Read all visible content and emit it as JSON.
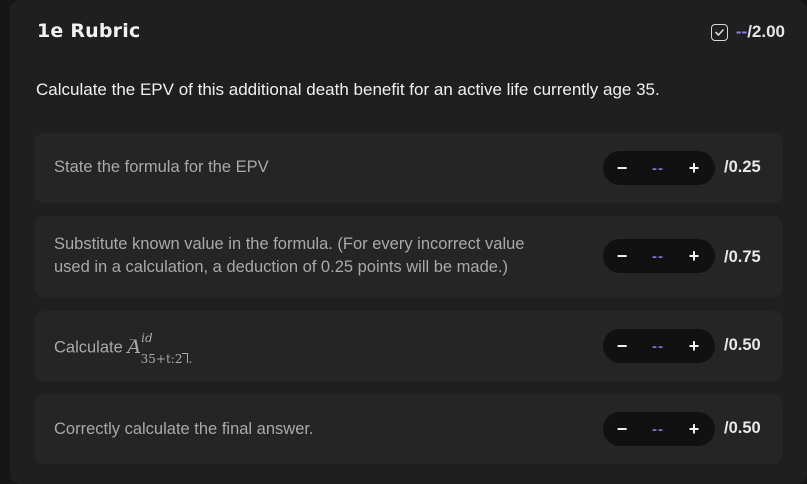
{
  "header": {
    "title": "1e Rubric",
    "score_value": "--",
    "score_max": "/2.00"
  },
  "question": "Calculate the EPV of this additional death benefit for an active life currently age 35.",
  "items": [
    {
      "text": "State the formula for the EPV",
      "value": "--",
      "max": "/0.25",
      "minus": "−",
      "plus": "+"
    },
    {
      "text_line1": "Substitute known value in the formula. (For every incorrect value",
      "text_line2": "used in a calculation, a deduction of 0.25 points will be made.)",
      "value": "--",
      "max": "/0.75",
      "minus": "−",
      "plus": "+"
    },
    {
      "text": "Calculate",
      "math_base": "A",
      "math_sup": "id",
      "math_sub": "35+t:2",
      "value": "--",
      "max": "/0.50",
      "minus": "−",
      "plus": "+"
    },
    {
      "text": "Correctly calculate the final answer.",
      "value": "--",
      "max": "/0.50",
      "minus": "−",
      "plus": "+"
    }
  ],
  "colors": {
    "accent": "#7c72d6",
    "background": "#1f1f20",
    "card": "#252526"
  },
  "icons": {
    "score_check": "checkbox-check-icon"
  }
}
